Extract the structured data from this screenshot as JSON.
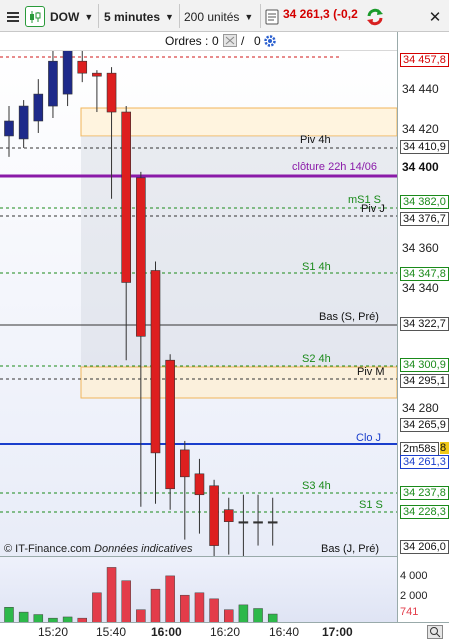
{
  "toolbar": {
    "menu_icon": "hamburger-menu-icon",
    "chart_type_icon": "candlestick-chart-icon",
    "instrument": "DOW",
    "timeframe": "5 minutes",
    "quantity": "200 unités",
    "price": "34 261,3",
    "change": "(-0,2",
    "refresh_icon": "refresh-arrows-icon",
    "close_icon": "close-icon"
  },
  "orders": {
    "label": "Ordres :",
    "buy_count": "0",
    "sep": "/",
    "sell_count": "0"
  },
  "price_axis": {
    "ticks": [
      "34 440",
      "34 420",
      "34 400",
      "34 380",
      "34 360",
      "34 340",
      "34 280"
    ],
    "labels": [
      {
        "text": "34 457,8",
        "color": "#d40000",
        "bold": false
      },
      {
        "text": "34 410,9",
        "color": "#111111",
        "bold": false
      },
      {
        "text": "34 400",
        "color": "#111111",
        "bold": true
      },
      {
        "text": "34 382,0",
        "color": "#1a8a1a",
        "bold": false
      },
      {
        "text": "34 376,7",
        "color": "#111111",
        "bold": false
      },
      {
        "text": "34 347,8",
        "color": "#1a8a1a",
        "bold": false
      },
      {
        "text": "34 322,7",
        "color": "#111111",
        "bold": false
      },
      {
        "text": "34 300,9",
        "color": "#1a8a1a",
        "bold": false
      },
      {
        "text": "34 295,1",
        "color": "#111111",
        "bold": false
      },
      {
        "text": "34 265,9",
        "color": "#111111",
        "bold": false
      },
      {
        "text": "2m58s",
        "color": "#111111",
        "bold": false
      },
      {
        "text": "34 261,3",
        "color": "#1a3ecc",
        "bold": false
      },
      {
        "text": "34 237,8",
        "color": "#1a8a1a",
        "bold": false
      },
      {
        "text": "34 228,3",
        "color": "#1a8a1a",
        "bold": false
      },
      {
        "text": "34 206,0",
        "color": "#111111",
        "bold": false
      }
    ]
  },
  "levels": {
    "piv_4h": "Piv 4h",
    "cloture": "clôture 22h 14/06",
    "ms1_s": "mS1 S",
    "piv_j": "Piv J",
    "s1_4h": "S1 4h",
    "bas_s_pre": "Bas (S, Pré)",
    "s2_4h": "S2 4h",
    "piv_m": "Piv M",
    "clo_j": "Clo J",
    "s3_4h": "S3 4h",
    "s1_s": "S1 S",
    "bas_j_pre": "Bas (J, Pré)"
  },
  "copyright": {
    "source": "© IT-Finance.com",
    "note": "Données indicatives"
  },
  "volume_axis": {
    "ticks": [
      "4 000",
      "2 000"
    ],
    "last": "741"
  },
  "time_axis": {
    "ticks": [
      "15:20",
      "15:40",
      "16:00",
      "16:20",
      "16:40",
      "17:00"
    ]
  },
  "colors": {
    "bull": "#1e2a8a",
    "bear": "#dd1f1f",
    "vol_up": "#2db84a",
    "vol_down": "#e33c4a",
    "close_line": "#1a3ecc",
    "cloture_line": "#8a1aa8"
  },
  "chart_data": {
    "type": "candlestick",
    "x": [
      "15:05",
      "15:10",
      "15:15",
      "15:20",
      "15:25",
      "15:30",
      "15:35",
      "15:40",
      "15:45",
      "15:50",
      "15:55",
      "16:00",
      "16:05",
      "16:10",
      "16:15",
      "16:20",
      "16:25",
      "16:30",
      "16:35"
    ],
    "series": [
      {
        "open": [
          34395,
          34394,
          34400,
          34405,
          34409,
          34420,
          34416,
          34416,
          34403,
          34381,
          34350,
          34320,
          34290,
          34282,
          34278,
          34270,
          34266,
          34266,
          34266
        ],
        "high": [
          34405,
          34407,
          34414,
          34424,
          34432,
          34436,
          34417,
          34418,
          34405,
          34383,
          34353,
          34322,
          34293,
          34287,
          34280,
          34274,
          34275,
          34275,
          34274
        ],
        "low": [
          34388,
          34391,
          34396,
          34401,
          34405,
          34413,
          34403,
          34374,
          34320,
          34271,
          34272,
          34270,
          34260,
          34262,
          34252,
          34255,
          34254,
          34258,
          34258
        ],
        "close": [
          34400,
          34405,
          34409,
          34420,
          34427,
          34416,
          34415,
          34403,
          34346,
          34328,
          34289,
          34277,
          34281,
          34275,
          34258,
          34266,
          34266,
          34266,
          34266
        ],
        "volume": [
          1300,
          900,
          700,
          400,
          500,
          400,
          2500,
          4600,
          3500,
          1100,
          2800,
          3900,
          2300,
          2500,
          2000,
          1100,
          1500,
          1200,
          741
        ]
      }
    ],
    "ylim": [
      34200,
      34460
    ],
    "volume_ticks": [
      2000,
      4000
    ]
  }
}
